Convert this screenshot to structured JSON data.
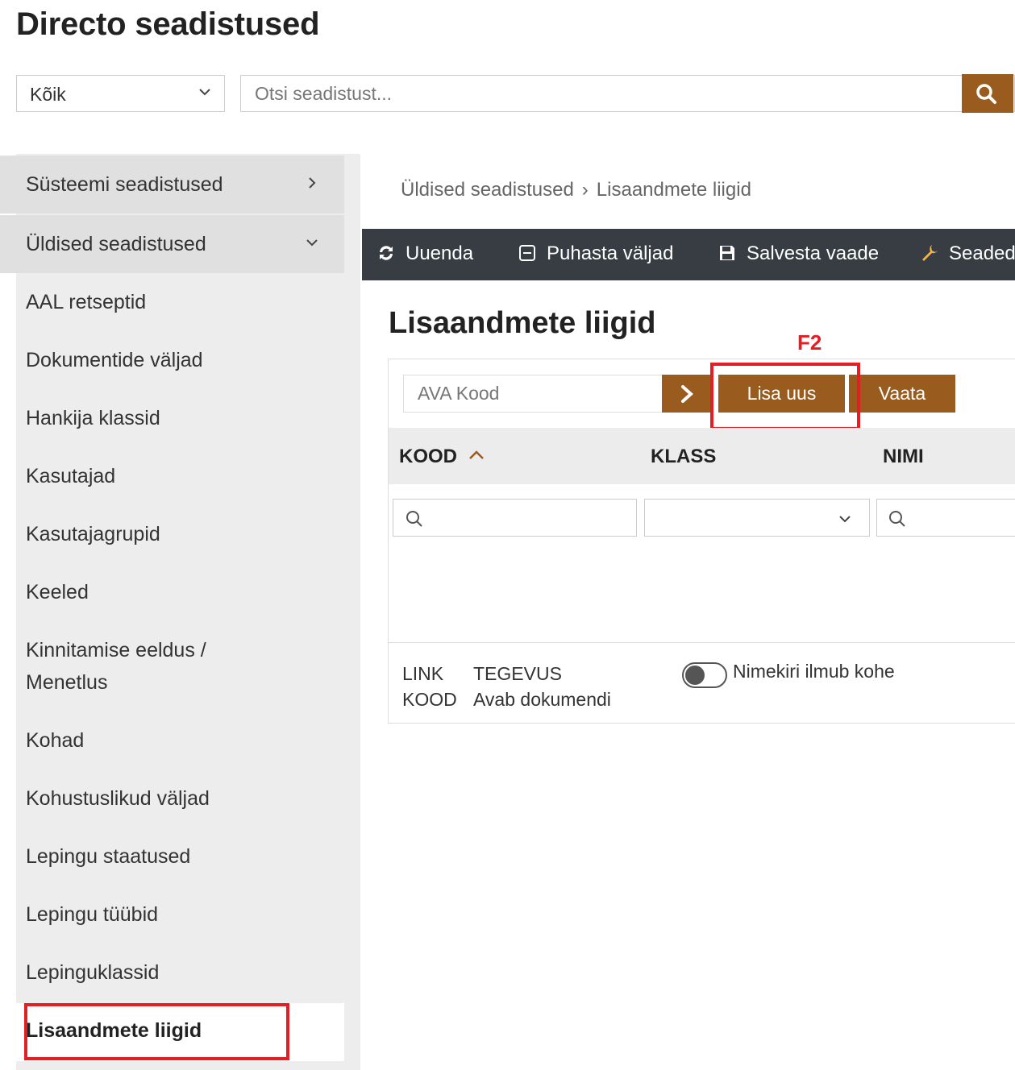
{
  "page": {
    "title": "Directo seadistused"
  },
  "filter": {
    "category_value": "Kõik",
    "search_placeholder": "Otsi seadistust..."
  },
  "sidebar": {
    "groups": [
      {
        "label": "Süsteemi seadistused",
        "icon": "chevron-right-icon"
      },
      {
        "label": "Üldised seadistused",
        "icon": "chevron-down-icon"
      }
    ],
    "items": [
      {
        "label": "AAL retseptid"
      },
      {
        "label": "Dokumentide väljad"
      },
      {
        "label": "Hankija klassid"
      },
      {
        "label": "Kasutajad"
      },
      {
        "label": "Kasutajagrupid"
      },
      {
        "label": "Keeled"
      },
      {
        "label": "Kinnitamise eeldus /\nMenetlus"
      },
      {
        "label": "Kohad"
      },
      {
        "label": "Kohustuslikud väljad"
      },
      {
        "label": "Lepingu staatused"
      },
      {
        "label": "Lepingu tüübid"
      },
      {
        "label": "Lepinguklassid"
      },
      {
        "label": "Lisaandmete liigid",
        "active": true
      }
    ]
  },
  "breadcrumb": {
    "parent": "Üldised seadistused",
    "separator": "›",
    "current": "Lisaandmete liigid"
  },
  "toolbar": {
    "items": [
      {
        "label": "Uuenda",
        "icon": "refresh-icon"
      },
      {
        "label": "Puhasta väljad",
        "icon": "clear-icon"
      },
      {
        "label": "Salvesta vaade",
        "icon": "save-icon"
      },
      {
        "label": "Seaded",
        "icon": "wrench-icon"
      }
    ]
  },
  "main": {
    "title": "Lisaandmete liigid",
    "shortcut_hint": "F2",
    "code_placeholder": "AVA Kood",
    "new_button": "Lisa uus",
    "view_button": "Vaata"
  },
  "table": {
    "columns": [
      {
        "label": "KOOD",
        "sort": "asc"
      },
      {
        "label": "KLASS"
      },
      {
        "label": "NIMI"
      }
    ]
  },
  "legend": {
    "link_label": "LINK",
    "code_label": "KOOD",
    "action_label": "TEGEVUS",
    "action_value": "Avab dokumendi",
    "toggle_label": "Nimekiri ilmub kohe",
    "toggle_on": false
  },
  "colors": {
    "accent": "#9a5b1f",
    "toolbar_bg": "#373d43",
    "highlight": "#e31e24",
    "sidebar_bg": "#ededed",
    "sidebar_group_bg": "#e0e0e0"
  }
}
